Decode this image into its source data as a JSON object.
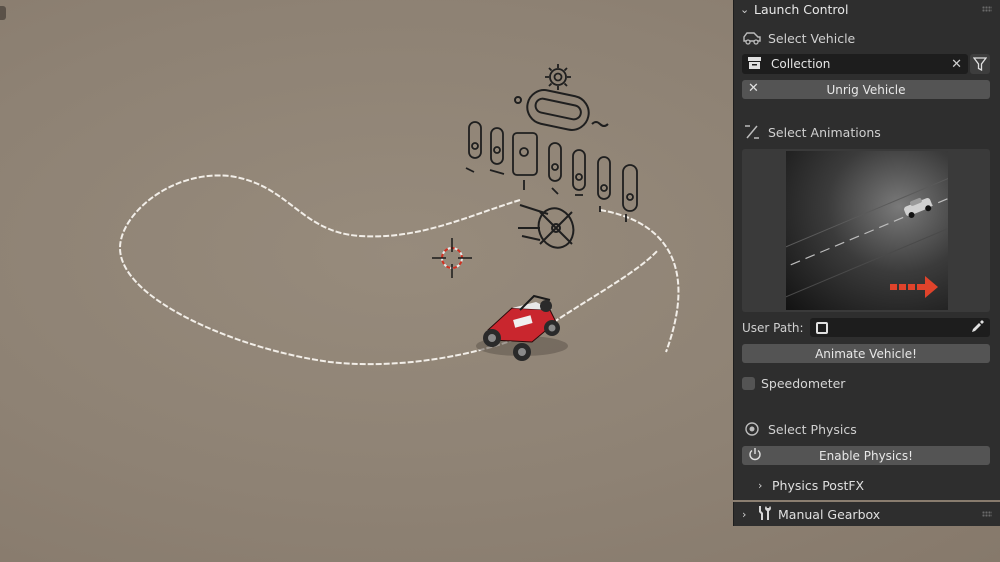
{
  "panel": {
    "title": "Launch Control",
    "select_vehicle_label": "Select Vehicle",
    "collection_value": "Collection",
    "unrig_button": "Unrig Vehicle",
    "select_animations_label": "Select Animations",
    "user_path_label": "User Path:",
    "user_path_value": "",
    "animate_button": "Animate Vehicle!",
    "speedometer_label": "Speedometer",
    "speedometer_checked": false,
    "select_physics_label": "Select Physics",
    "enable_physics_button": "Enable Physics!",
    "physics_postfx_label": "Physics PostFX"
  },
  "bottom_panel": {
    "title": "Manual Gearbox"
  },
  "colors": {
    "viewport_bg": "#8f8476",
    "panel_bg": "#2e2e2e",
    "button_bg": "#545454",
    "field_bg": "#1d1d1d",
    "accent_red": "#e0432b"
  },
  "icons": [
    "car-icon",
    "collection-icon",
    "clear-icon",
    "filter-icon",
    "close-icon",
    "animation-curve-icon",
    "image-icon",
    "eyedropper-icon",
    "physics-icon",
    "power-icon",
    "tools-icon",
    "chevron-down-icon",
    "chevron-right-icon",
    "3d-cursor-icon",
    "gear-icon"
  ]
}
